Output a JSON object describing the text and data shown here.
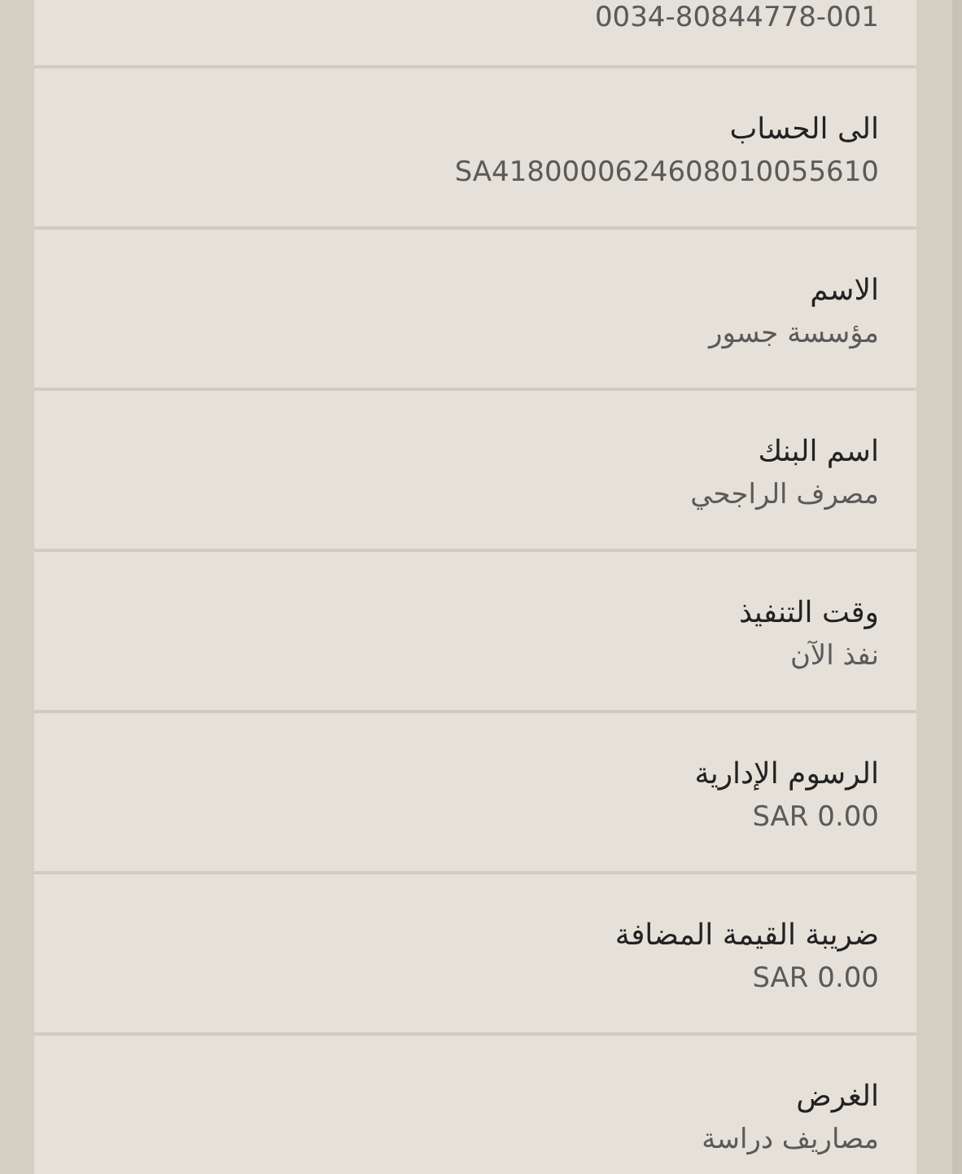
{
  "details": [
    {
      "value": "0034-80844778-001"
    },
    {
      "label": "الى الحساب",
      "value": "SA4180000624608010055610"
    },
    {
      "label": "الاسم",
      "value": "مؤسسة جسور"
    },
    {
      "label": "اسم البنك",
      "value": "مصرف الراجحي"
    },
    {
      "label": "وقت التنفيذ",
      "value": "نفذ الآن"
    },
    {
      "label": "الرسوم الإدارية",
      "value": "SAR 0.00"
    },
    {
      "label": "ضريبة القيمة المضافة",
      "value": "SAR 0.00"
    },
    {
      "label": "الغرض",
      "value": "مصاريف دراسة"
    }
  ]
}
